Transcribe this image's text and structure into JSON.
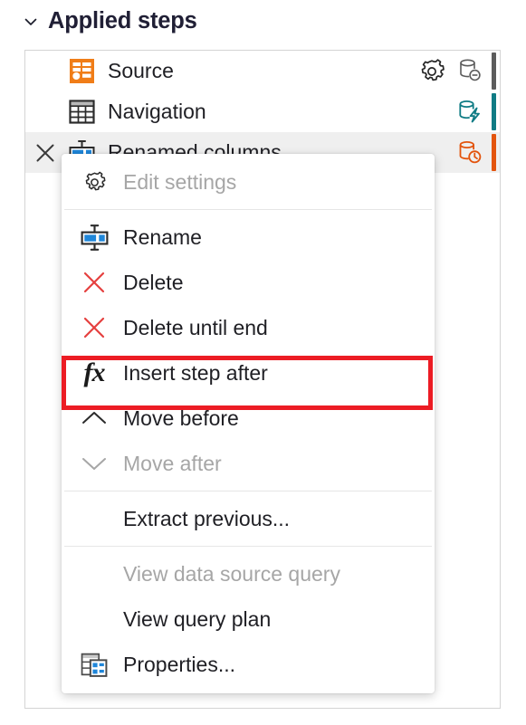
{
  "header": {
    "chevron_icon": "chevron-down-icon",
    "title": "Applied steps"
  },
  "steps_panel": {
    "steps": [
      {
        "label": "Source",
        "icon": "source-table-icon",
        "selected": false,
        "has_gear": true,
        "gear_icon": "gear-icon",
        "fold_icon": "folding-not-supported-icon",
        "fold_color": "#5c5c5c",
        "delete_icon": null
      },
      {
        "label": "Navigation",
        "icon": "table-grid-icon",
        "selected": false,
        "has_gear": false,
        "gear_icon": "gear-icon",
        "fold_icon": "folding-supported-icon",
        "fold_color": "#0f7b84",
        "delete_icon": null
      },
      {
        "label": "Renamed columns",
        "icon": "rename-columns-icon",
        "selected": true,
        "has_gear": false,
        "gear_icon": "gear-icon",
        "fold_icon": "folding-evaluation-icon",
        "fold_color": "#e3540d",
        "delete_icon": "close-x-icon"
      }
    ]
  },
  "context_menu": {
    "items": [
      {
        "label": "Edit settings",
        "icon": "gear-icon",
        "disabled": true,
        "separator_after": true
      },
      {
        "label": "Rename",
        "icon": "rename-icon",
        "disabled": false,
        "separator_after": false
      },
      {
        "label": "Delete",
        "icon": "delete-x-icon",
        "disabled": false,
        "separator_after": false
      },
      {
        "label": "Delete until end",
        "icon": "delete-x-icon",
        "disabled": false,
        "separator_after": false
      },
      {
        "label": "Insert step after",
        "icon": "fx-icon",
        "disabled": false,
        "separator_after": false,
        "highlighted": true
      },
      {
        "label": "Move before",
        "icon": "chevron-up-icon",
        "disabled": false,
        "separator_after": false
      },
      {
        "label": "Move after",
        "icon": "chevron-down-icon",
        "disabled": true,
        "separator_after": true
      },
      {
        "label": "Extract previous...",
        "icon": null,
        "disabled": false,
        "separator_after": true
      },
      {
        "label": "View data source query",
        "icon": null,
        "disabled": true,
        "separator_after": false
      },
      {
        "label": "View query plan",
        "icon": null,
        "disabled": false,
        "separator_after": false
      },
      {
        "label": "Properties...",
        "icon": "properties-icon",
        "disabled": false,
        "separator_after": false
      }
    ]
  },
  "highlight": {
    "color": "#ec1c24",
    "target_label": "Insert step after"
  }
}
